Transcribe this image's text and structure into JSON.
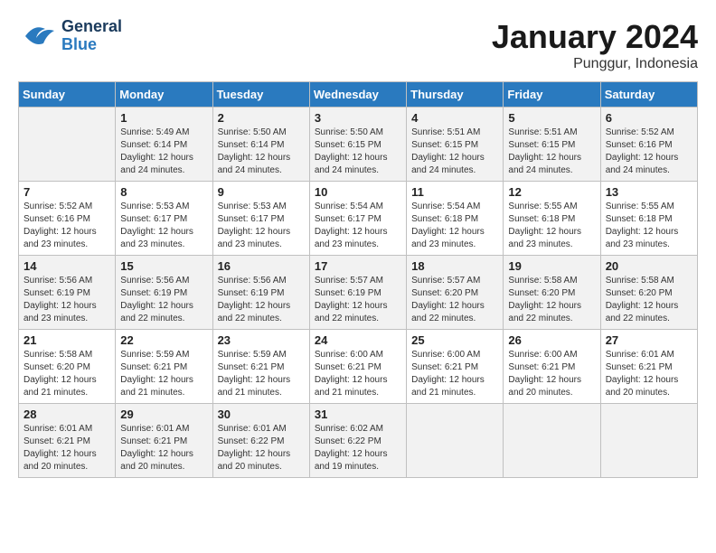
{
  "header": {
    "logo_line1": "General",
    "logo_line2": "Blue",
    "month": "January 2024",
    "location": "Punggur, Indonesia"
  },
  "weekdays": [
    "Sunday",
    "Monday",
    "Tuesday",
    "Wednesday",
    "Thursday",
    "Friday",
    "Saturday"
  ],
  "weeks": [
    [
      {
        "day": "",
        "info": ""
      },
      {
        "day": "1",
        "info": "Sunrise: 5:49 AM\nSunset: 6:14 PM\nDaylight: 12 hours\nand 24 minutes."
      },
      {
        "day": "2",
        "info": "Sunrise: 5:50 AM\nSunset: 6:14 PM\nDaylight: 12 hours\nand 24 minutes."
      },
      {
        "day": "3",
        "info": "Sunrise: 5:50 AM\nSunset: 6:15 PM\nDaylight: 12 hours\nand 24 minutes."
      },
      {
        "day": "4",
        "info": "Sunrise: 5:51 AM\nSunset: 6:15 PM\nDaylight: 12 hours\nand 24 minutes."
      },
      {
        "day": "5",
        "info": "Sunrise: 5:51 AM\nSunset: 6:15 PM\nDaylight: 12 hours\nand 24 minutes."
      },
      {
        "day": "6",
        "info": "Sunrise: 5:52 AM\nSunset: 6:16 PM\nDaylight: 12 hours\nand 24 minutes."
      }
    ],
    [
      {
        "day": "7",
        "info": "Sunrise: 5:52 AM\nSunset: 6:16 PM\nDaylight: 12 hours\nand 23 minutes."
      },
      {
        "day": "8",
        "info": "Sunrise: 5:53 AM\nSunset: 6:17 PM\nDaylight: 12 hours\nand 23 minutes."
      },
      {
        "day": "9",
        "info": "Sunrise: 5:53 AM\nSunset: 6:17 PM\nDaylight: 12 hours\nand 23 minutes."
      },
      {
        "day": "10",
        "info": "Sunrise: 5:54 AM\nSunset: 6:17 PM\nDaylight: 12 hours\nand 23 minutes."
      },
      {
        "day": "11",
        "info": "Sunrise: 5:54 AM\nSunset: 6:18 PM\nDaylight: 12 hours\nand 23 minutes."
      },
      {
        "day": "12",
        "info": "Sunrise: 5:55 AM\nSunset: 6:18 PM\nDaylight: 12 hours\nand 23 minutes."
      },
      {
        "day": "13",
        "info": "Sunrise: 5:55 AM\nSunset: 6:18 PM\nDaylight: 12 hours\nand 23 minutes."
      }
    ],
    [
      {
        "day": "14",
        "info": "Sunrise: 5:56 AM\nSunset: 6:19 PM\nDaylight: 12 hours\nand 23 minutes."
      },
      {
        "day": "15",
        "info": "Sunrise: 5:56 AM\nSunset: 6:19 PM\nDaylight: 12 hours\nand 22 minutes."
      },
      {
        "day": "16",
        "info": "Sunrise: 5:56 AM\nSunset: 6:19 PM\nDaylight: 12 hours\nand 22 minutes."
      },
      {
        "day": "17",
        "info": "Sunrise: 5:57 AM\nSunset: 6:19 PM\nDaylight: 12 hours\nand 22 minutes."
      },
      {
        "day": "18",
        "info": "Sunrise: 5:57 AM\nSunset: 6:20 PM\nDaylight: 12 hours\nand 22 minutes."
      },
      {
        "day": "19",
        "info": "Sunrise: 5:58 AM\nSunset: 6:20 PM\nDaylight: 12 hours\nand 22 minutes."
      },
      {
        "day": "20",
        "info": "Sunrise: 5:58 AM\nSunset: 6:20 PM\nDaylight: 12 hours\nand 22 minutes."
      }
    ],
    [
      {
        "day": "21",
        "info": "Sunrise: 5:58 AM\nSunset: 6:20 PM\nDaylight: 12 hours\nand 21 minutes."
      },
      {
        "day": "22",
        "info": "Sunrise: 5:59 AM\nSunset: 6:21 PM\nDaylight: 12 hours\nand 21 minutes."
      },
      {
        "day": "23",
        "info": "Sunrise: 5:59 AM\nSunset: 6:21 PM\nDaylight: 12 hours\nand 21 minutes."
      },
      {
        "day": "24",
        "info": "Sunrise: 6:00 AM\nSunset: 6:21 PM\nDaylight: 12 hours\nand 21 minutes."
      },
      {
        "day": "25",
        "info": "Sunrise: 6:00 AM\nSunset: 6:21 PM\nDaylight: 12 hours\nand 21 minutes."
      },
      {
        "day": "26",
        "info": "Sunrise: 6:00 AM\nSunset: 6:21 PM\nDaylight: 12 hours\nand 20 minutes."
      },
      {
        "day": "27",
        "info": "Sunrise: 6:01 AM\nSunset: 6:21 PM\nDaylight: 12 hours\nand 20 minutes."
      }
    ],
    [
      {
        "day": "28",
        "info": "Sunrise: 6:01 AM\nSunset: 6:21 PM\nDaylight: 12 hours\nand 20 minutes."
      },
      {
        "day": "29",
        "info": "Sunrise: 6:01 AM\nSunset: 6:21 PM\nDaylight: 12 hours\nand 20 minutes."
      },
      {
        "day": "30",
        "info": "Sunrise: 6:01 AM\nSunset: 6:22 PM\nDaylight: 12 hours\nand 20 minutes."
      },
      {
        "day": "31",
        "info": "Sunrise: 6:02 AM\nSunset: 6:22 PM\nDaylight: 12 hours\nand 19 minutes."
      },
      {
        "day": "",
        "info": ""
      },
      {
        "day": "",
        "info": ""
      },
      {
        "day": "",
        "info": ""
      }
    ]
  ]
}
